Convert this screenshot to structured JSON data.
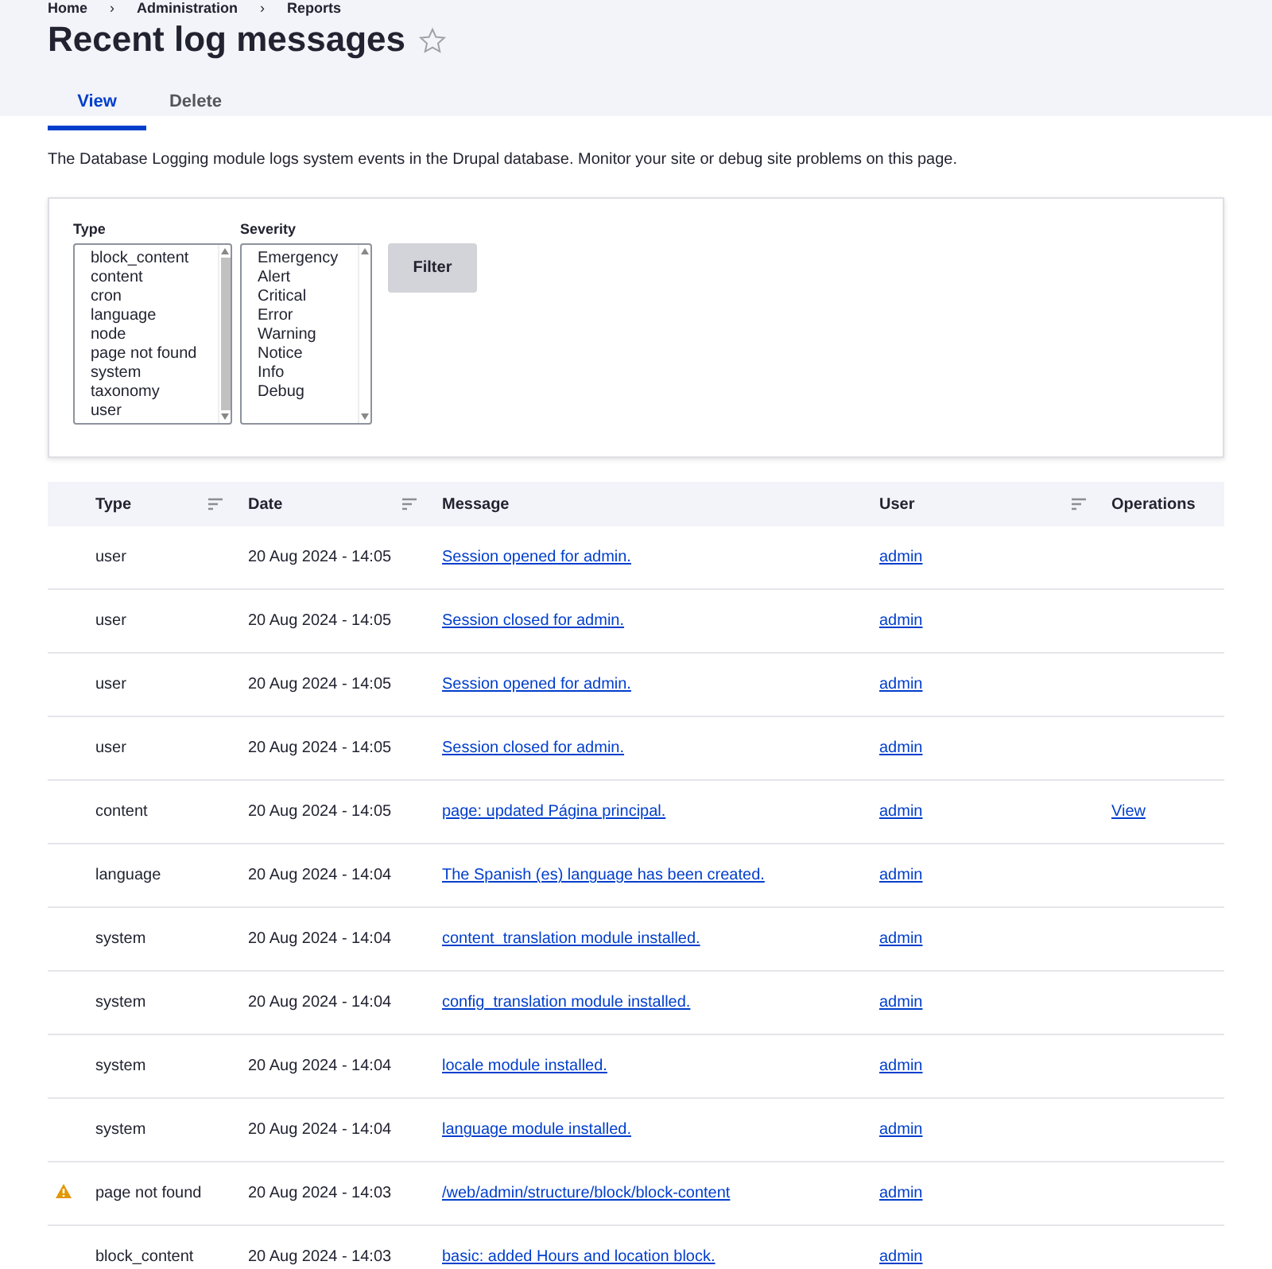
{
  "breadcrumb": [
    "Home",
    "Administration",
    "Reports"
  ],
  "breadcrumb_separator": "›",
  "title": "Recent log messages",
  "tabs": [
    {
      "label": "View",
      "selected": true
    },
    {
      "label": "Delete",
      "selected": false
    }
  ],
  "description": "The Database Logging module logs system events in the Drupal database. Monitor your site or debug site problems on this page.",
  "filter": {
    "type_label": "Type",
    "type_options": [
      "block_content",
      "content",
      "cron",
      "language",
      "node",
      "page not found",
      "system",
      "taxonomy",
      "user"
    ],
    "severity_label": "Severity",
    "severity_options": [
      "Emergency",
      "Alert",
      "Critical",
      "Error",
      "Warning",
      "Notice",
      "Info",
      "Debug"
    ],
    "button": "Filter"
  },
  "table": {
    "columns": [
      {
        "label": "Type",
        "sortable": true
      },
      {
        "label": "Date",
        "sortable": true
      },
      {
        "label": "Message",
        "sortable": false
      },
      {
        "label": "User",
        "sortable": true
      },
      {
        "label": "Operations",
        "sortable": false
      }
    ],
    "rows": [
      {
        "warning": false,
        "type": "user",
        "date": "20 Aug 2024 - 14:05",
        "message": "Session opened for admin.",
        "user": "admin"
      },
      {
        "warning": false,
        "type": "user",
        "date": "20 Aug 2024 - 14:05",
        "message": "Session closed for admin.",
        "user": "admin"
      },
      {
        "warning": false,
        "type": "user",
        "date": "20 Aug 2024 - 14:05",
        "message": "Session opened for admin.",
        "user": "admin"
      },
      {
        "warning": false,
        "type": "user",
        "date": "20 Aug 2024 - 14:05",
        "message": "Session closed for admin.",
        "user": "admin"
      },
      {
        "warning": false,
        "type": "content",
        "date": "20 Aug 2024 - 14:05",
        "message": "page: updated Página principal.",
        "user": "admin",
        "operation": "View"
      },
      {
        "warning": false,
        "type": "language",
        "date": "20 Aug 2024 - 14:04",
        "message": "The Spanish (es) language has been created.",
        "user": "admin"
      },
      {
        "warning": false,
        "type": "system",
        "date": "20 Aug 2024 - 14:04",
        "message": "content_translation module installed.",
        "user": "admin"
      },
      {
        "warning": false,
        "type": "system",
        "date": "20 Aug 2024 - 14:04",
        "message": "config_translation module installed.",
        "user": "admin"
      },
      {
        "warning": false,
        "type": "system",
        "date": "20 Aug 2024 - 14:04",
        "message": "locale module installed.",
        "user": "admin"
      },
      {
        "warning": false,
        "type": "system",
        "date": "20 Aug 2024 - 14:04",
        "message": "language module installed.",
        "user": "admin"
      },
      {
        "warning": true,
        "type": "page not found",
        "date": "20 Aug 2024 - 14:03",
        "message": "/web/admin/structure/block/block-content",
        "user": "admin"
      },
      {
        "warning": false,
        "type": "block_content",
        "date": "20 Aug 2024 - 14:03",
        "message": "basic: added Hours and location block.",
        "user": "admin"
      }
    ]
  }
}
